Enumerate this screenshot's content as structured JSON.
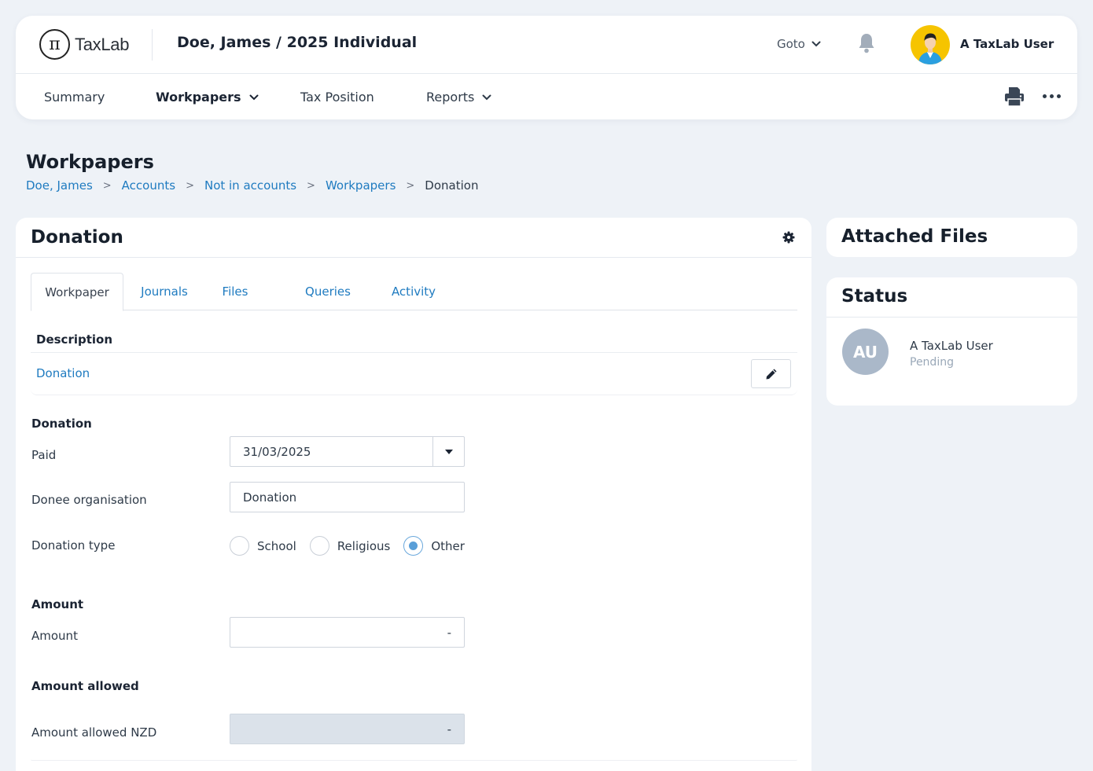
{
  "app": {
    "logo_text": "TaxLab",
    "logo_symbol": "π",
    "client_title": "Doe, James / 2025 Individual",
    "goto_label": "Goto",
    "user_name": "A TaxLab User"
  },
  "nav": {
    "items": [
      {
        "label": "Summary",
        "active": false,
        "dropdown": false
      },
      {
        "label": "Workpapers",
        "active": true,
        "dropdown": true
      },
      {
        "label": "Tax Position",
        "active": false,
        "dropdown": false
      },
      {
        "label": "Reports",
        "active": false,
        "dropdown": true
      }
    ]
  },
  "page": {
    "title": "Workpapers",
    "breadcrumb": [
      "Doe, James",
      "Accounts",
      "Not in accounts",
      "Workpapers"
    ],
    "breadcrumb_current": "Donation"
  },
  "workpaper": {
    "title": "Donation",
    "tabs": [
      "Workpaper",
      "Journals",
      "Files",
      "Queries",
      "Activity"
    ],
    "active_tab": "Workpaper",
    "description_label": "Description",
    "description_value": "Donation",
    "donation_section": "Donation",
    "paid_label": "Paid",
    "paid_value": "31/03/2025",
    "donee_label": "Donee organisation",
    "donee_value": "Donation",
    "type_label": "Donation type",
    "type_options": [
      "School",
      "Religious",
      "Other"
    ],
    "type_selected": "Other",
    "amount_section": "Amount",
    "amount_label": "Amount",
    "amount_value": "-",
    "allowed_section": "Amount allowed",
    "allowed_label": "Amount allowed NZD",
    "allowed_value": "-"
  },
  "sidebar": {
    "attached_title": "Attached Files",
    "status_title": "Status",
    "status_initials": "AU",
    "status_user": "A TaxLab User",
    "status_state": "Pending"
  },
  "colors": {
    "link": "#1f7bc0",
    "background": "#eef2f7",
    "radio_checked": "#5a9fd8",
    "avatar_yellow": "#f6c400",
    "status_avatar": "#aab8c9"
  }
}
